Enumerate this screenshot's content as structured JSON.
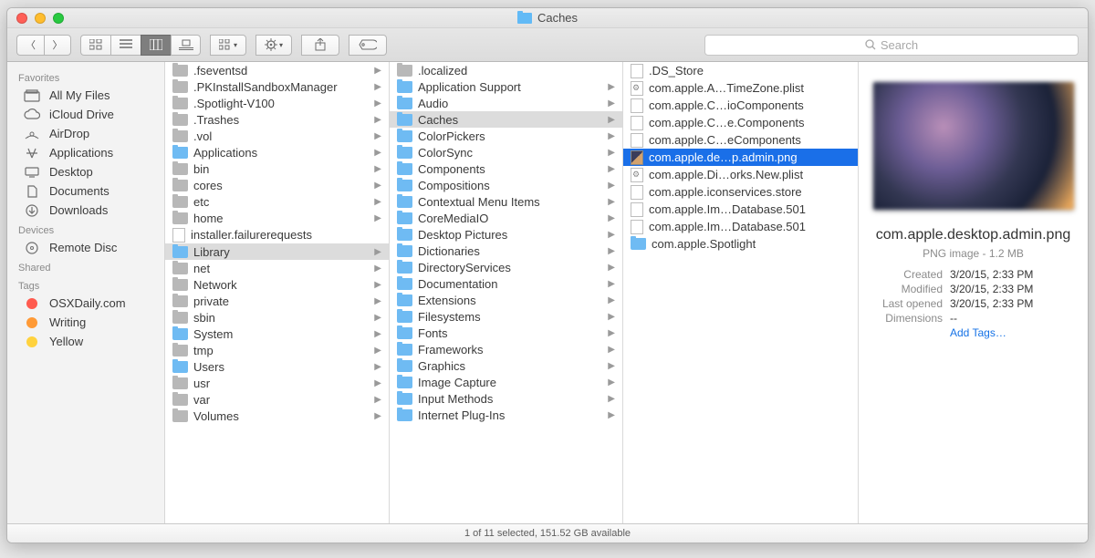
{
  "window": {
    "title": "Caches"
  },
  "toolbar": {
    "search_placeholder": "Search"
  },
  "sidebar": {
    "sections": [
      {
        "header": "Favorites",
        "items": [
          {
            "icon": "all-my-files",
            "label": "All My Files"
          },
          {
            "icon": "icloud",
            "label": "iCloud Drive"
          },
          {
            "icon": "airdrop",
            "label": "AirDrop"
          },
          {
            "icon": "applications",
            "label": "Applications"
          },
          {
            "icon": "desktop",
            "label": "Desktop"
          },
          {
            "icon": "documents",
            "label": "Documents"
          },
          {
            "icon": "downloads",
            "label": "Downloads"
          }
        ]
      },
      {
        "header": "Devices",
        "items": [
          {
            "icon": "disc",
            "label": "Remote Disc"
          }
        ]
      },
      {
        "header": "Shared",
        "items": []
      },
      {
        "header": "Tags",
        "items": [
          {
            "icon": "tag",
            "color": "#ff5b4f",
            "label": "OSXDaily.com"
          },
          {
            "icon": "tag",
            "color": "#ff9a36",
            "label": "Writing"
          },
          {
            "icon": "tag",
            "color": "#ffd23e",
            "label": "Yellow"
          }
        ]
      }
    ]
  },
  "columns": {
    "c1": [
      {
        "t": "folder-grey",
        "name": ".fseventsd",
        "arr": true
      },
      {
        "t": "folder-grey",
        "name": ".PKInstallSandboxManager",
        "arr": true
      },
      {
        "t": "folder-grey",
        "name": ".Spotlight-V100",
        "arr": true
      },
      {
        "t": "folder-grey",
        "name": ".Trashes",
        "arr": true
      },
      {
        "t": "folder-grey",
        "name": ".vol",
        "arr": true
      },
      {
        "t": "folder",
        "name": "Applications",
        "arr": true
      },
      {
        "t": "folder-grey",
        "name": "bin",
        "arr": true
      },
      {
        "t": "folder-grey",
        "name": "cores",
        "arr": true
      },
      {
        "t": "folder-grey",
        "name": "etc",
        "arr": true
      },
      {
        "t": "folder-grey",
        "name": "home",
        "arr": true
      },
      {
        "t": "doc",
        "name": "installer.failurerequests"
      },
      {
        "t": "folder",
        "name": "Library",
        "arr": true,
        "sel": "grey"
      },
      {
        "t": "folder-grey",
        "name": "net",
        "arr": true
      },
      {
        "t": "folder-grey",
        "name": "Network",
        "arr": true
      },
      {
        "t": "folder-grey",
        "name": "private",
        "arr": true
      },
      {
        "t": "folder-grey",
        "name": "sbin",
        "arr": true
      },
      {
        "t": "folder",
        "name": "System",
        "arr": true
      },
      {
        "t": "folder-grey",
        "name": "tmp",
        "arr": true
      },
      {
        "t": "folder",
        "name": "Users",
        "arr": true
      },
      {
        "t": "folder-grey",
        "name": "usr",
        "arr": true
      },
      {
        "t": "folder-grey",
        "name": "var",
        "arr": true
      },
      {
        "t": "folder-grey",
        "name": "Volumes",
        "arr": true
      }
    ],
    "c2": [
      {
        "t": "folder-grey",
        "name": ".localized"
      },
      {
        "t": "folder",
        "name": "Application Support",
        "arr": true
      },
      {
        "t": "folder",
        "name": "Audio",
        "arr": true
      },
      {
        "t": "folder",
        "name": "Caches",
        "arr": true,
        "sel": "grey"
      },
      {
        "t": "folder",
        "name": "ColorPickers",
        "arr": true
      },
      {
        "t": "folder",
        "name": "ColorSync",
        "arr": true
      },
      {
        "t": "folder",
        "name": "Components",
        "arr": true
      },
      {
        "t": "folder",
        "name": "Compositions",
        "arr": true
      },
      {
        "t": "folder",
        "name": "Contextual Menu Items",
        "arr": true
      },
      {
        "t": "folder",
        "name": "CoreMediaIO",
        "arr": true
      },
      {
        "t": "folder",
        "name": "Desktop Pictures",
        "arr": true
      },
      {
        "t": "folder",
        "name": "Dictionaries",
        "arr": true
      },
      {
        "t": "folder",
        "name": "DirectoryServices",
        "arr": true
      },
      {
        "t": "folder",
        "name": "Documentation",
        "arr": true
      },
      {
        "t": "folder",
        "name": "Extensions",
        "arr": true
      },
      {
        "t": "folder",
        "name": "Filesystems",
        "arr": true
      },
      {
        "t": "folder",
        "name": "Fonts",
        "arr": true
      },
      {
        "t": "folder",
        "name": "Frameworks",
        "arr": true
      },
      {
        "t": "folder",
        "name": "Graphics",
        "arr": true
      },
      {
        "t": "folder",
        "name": "Image Capture",
        "arr": true
      },
      {
        "t": "folder",
        "name": "Input Methods",
        "arr": true
      },
      {
        "t": "folder",
        "name": "Internet Plug-Ins",
        "arr": true
      }
    ],
    "c3": [
      {
        "t": "doc",
        "name": ".DS_Store"
      },
      {
        "t": "gear",
        "name": "com.apple.A…TimeZone.plist"
      },
      {
        "t": "doc",
        "name": "com.apple.C…ioComponents"
      },
      {
        "t": "doc",
        "name": "com.apple.C…e.Components"
      },
      {
        "t": "doc",
        "name": "com.apple.C…eComponents"
      },
      {
        "t": "img",
        "name": "com.apple.de…p.admin.png",
        "sel": "blue"
      },
      {
        "t": "gear",
        "name": "com.apple.Di…orks.New.plist"
      },
      {
        "t": "doc",
        "name": "com.apple.iconservices.store"
      },
      {
        "t": "doc",
        "name": "com.apple.Im…Database.501"
      },
      {
        "t": "doc",
        "name": "com.apple.Im…Database.501"
      },
      {
        "t": "folder",
        "name": "com.apple.Spotlight"
      }
    ]
  },
  "preview": {
    "filename": "com.apple.desktop.admin.png",
    "kind": "PNG image - 1.2 MB",
    "meta": [
      {
        "k": "Created",
        "v": "3/20/15, 2:33 PM"
      },
      {
        "k": "Modified",
        "v": "3/20/15, 2:33 PM"
      },
      {
        "k": "Last opened",
        "v": "3/20/15, 2:33 PM"
      },
      {
        "k": "Dimensions",
        "v": "--"
      }
    ],
    "addtags": "Add Tags…"
  },
  "status": "1 of 11 selected, 151.52 GB available"
}
